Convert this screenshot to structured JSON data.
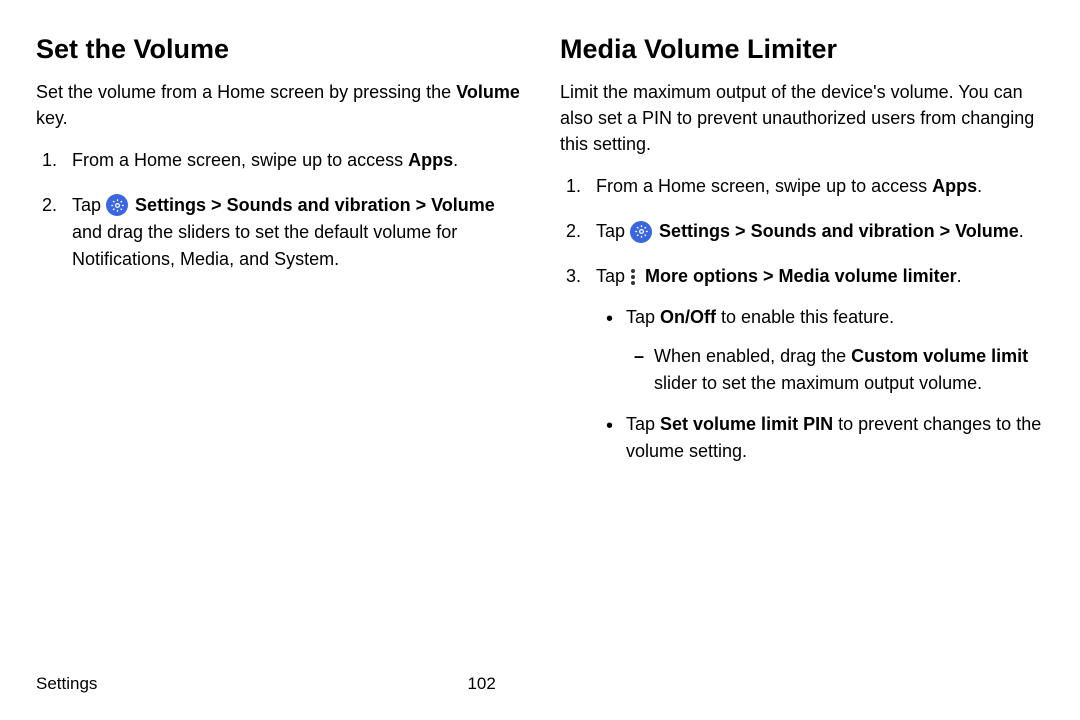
{
  "left": {
    "heading": "Set the Volume",
    "intro_pre": "Set the volume from a Home screen by pressing the ",
    "intro_bold": "Volume",
    "intro_post": " key.",
    "step1_pre": "From a Home screen, swipe up to access ",
    "step1_bold": "Apps",
    "step1_post": ".",
    "step2_tap": "Tap ",
    "step2_bold": "Settings > Sounds and vibration > Volume",
    "step2_rest": " and drag the sliders to set the default volume for Notifications, Media, and System."
  },
  "right": {
    "heading": "Media Volume Limiter",
    "intro": "Limit the maximum output of the device's volume. You can also set a PIN to prevent unauthorized users from changing this setting.",
    "step1_pre": "From a Home screen, swipe up to access ",
    "step1_bold": "Apps",
    "step1_post": ".",
    "step2_tap": "Tap ",
    "step2_bold": "Settings > Sounds and vibration > Volume",
    "step2_post": ".",
    "step3_tap": "Tap ",
    "step3_bold": "More options > Media volume limiter",
    "step3_post": ".",
    "bullet1_pre": "Tap ",
    "bullet1_bold": "On/Off",
    "bullet1_post": " to enable this feature.",
    "dash1_pre": "When enabled, drag the ",
    "dash1_bold": "Custom volume limit",
    "dash1_post": " slider to set the maximum output volume.",
    "bullet2_pre": "Tap ",
    "bullet2_bold": "Set volume limit PIN",
    "bullet2_post": " to prevent changes to the volume setting."
  },
  "footer": {
    "section": "Settings",
    "page": "102"
  }
}
